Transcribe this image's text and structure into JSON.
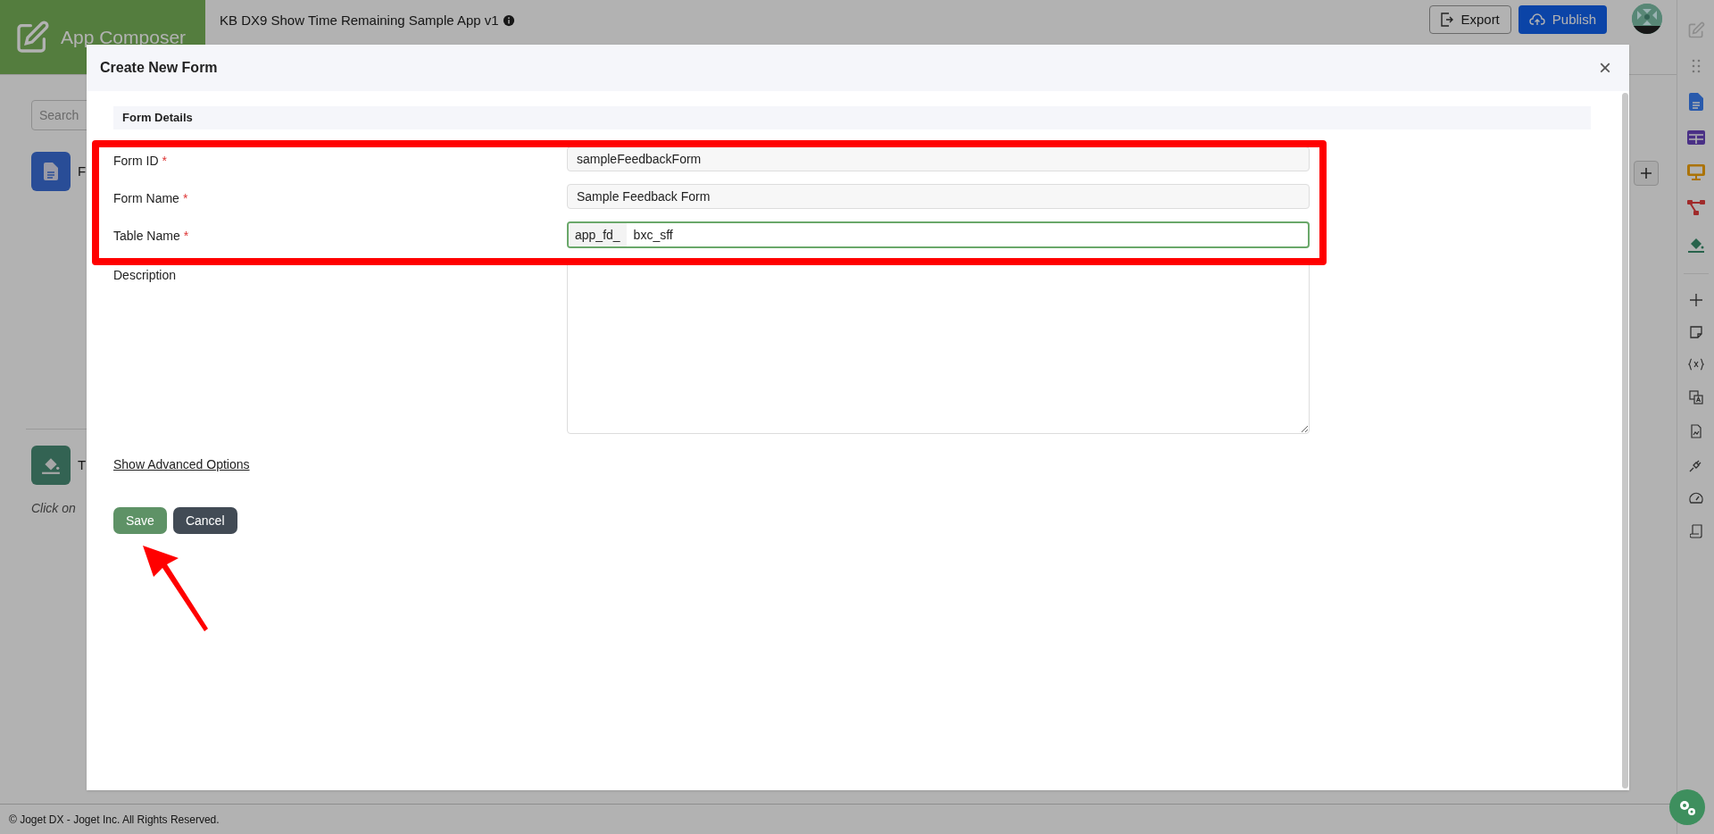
{
  "header": {
    "app_name": "App Composer",
    "app_title": "KB DX9 Show Time Remaining Sample App v1",
    "buttons": [
      {
        "label": "Export",
        "kind": "outline"
      },
      {
        "label": "Publish",
        "kind": "primary"
      }
    ]
  },
  "background": {
    "search_placeholder": "Search",
    "items": [
      {
        "label": "F",
        "kind": "form"
      },
      {
        "label": "T",
        "kind": "theme"
      }
    ],
    "hint": "Click on"
  },
  "footer": "© Joget DX - Joget Inc. All Rights Reserved.",
  "modal": {
    "title": "Create New Form",
    "close": "×",
    "section": "Form Details",
    "fields": [
      {
        "label": "Form ID",
        "required_mark": "*",
        "kind": "text",
        "value": "sampleFeedbackForm",
        "focused": false
      },
      {
        "label": "Form Name",
        "required_mark": "*",
        "kind": "text",
        "value": "Sample Feedback Form",
        "focused": false
      },
      {
        "label": "Table Name",
        "required_mark": "*",
        "kind": "prefixed",
        "prefix": "app_fd_",
        "value": "bxc_sff",
        "focused": true
      },
      {
        "label": "Description",
        "kind": "textarea",
        "focused": false
      }
    ],
    "advanced_link": "Show Advanced Options",
    "buttons": [
      {
        "label": "Save",
        "kind": "save"
      },
      {
        "label": "Cancel",
        "kind": "cancel"
      }
    ]
  }
}
